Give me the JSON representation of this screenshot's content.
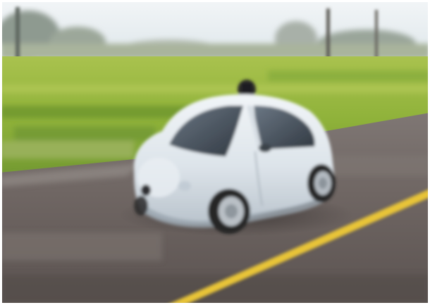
{
  "image": {
    "subject": "compact-autonomous-car",
    "scene_elements": [
      "sky",
      "trees",
      "grass-field",
      "asphalt-road",
      "yellow-lane-line",
      "utility-poles",
      "car"
    ],
    "colors": {
      "sky": "#e4ecf1",
      "grass": "#8fb23a",
      "grass_dark": "#5f8a26",
      "road": "#6e6562",
      "road_light": "#8d8684",
      "lane_line": "#e8c437",
      "car_body": "#dfe6ec",
      "car_shadow": "#a9b4bf",
      "window": "#3d4650",
      "tire": "#262626"
    }
  }
}
